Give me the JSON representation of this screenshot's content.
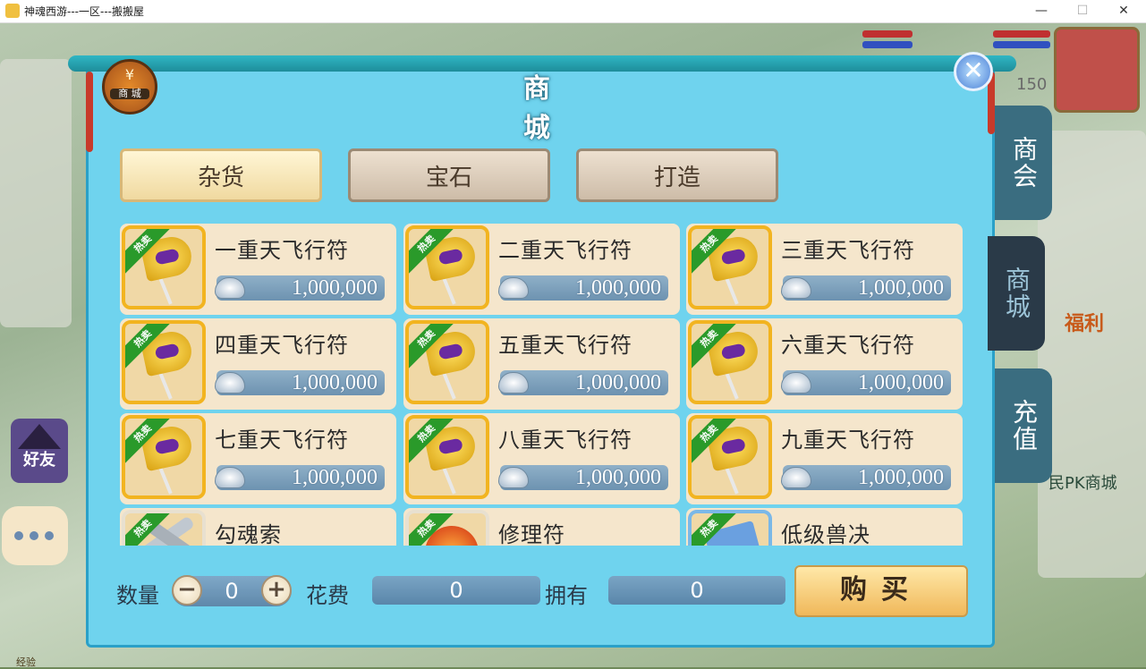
{
  "window": {
    "title": "神魂西游---一区---搬搬屋",
    "minimize": "—",
    "maximize": "☐",
    "close": "✕"
  },
  "background": {
    "level": "150",
    "welfare": "福利",
    "pk_shop": "民PK商城",
    "friend": "好友",
    "exp": "经验"
  },
  "shop": {
    "title": "商 城",
    "badge_symbol": "¥",
    "badge_label": "商 城",
    "close_symbol": "✕",
    "side_tabs": [
      {
        "label": "商会",
        "active": false
      },
      {
        "label": "商城",
        "active": true
      },
      {
        "label": "充值",
        "active": false
      }
    ],
    "category_tabs": [
      {
        "label": "杂货",
        "active": true
      },
      {
        "label": "宝石",
        "active": false
      },
      {
        "label": "打造",
        "active": false
      }
    ],
    "hot_tag": "热卖",
    "items": [
      {
        "name": "一重天飞行符",
        "price": "1,000,000",
        "icon": "flag-icon"
      },
      {
        "name": "二重天飞行符",
        "price": "1,000,000",
        "icon": "flag-icon"
      },
      {
        "name": "三重天飞行符",
        "price": "1,000,000",
        "icon": "flag-icon"
      },
      {
        "name": "四重天飞行符",
        "price": "1,000,000",
        "icon": "flag-icon"
      },
      {
        "name": "五重天飞行符",
        "price": "1,000,000",
        "icon": "flag-icon"
      },
      {
        "name": "六重天飞行符",
        "price": "1,000,000",
        "icon": "flag-icon"
      },
      {
        "name": "七重天飞行符",
        "price": "1,000,000",
        "icon": "flag-icon"
      },
      {
        "name": "八重天飞行符",
        "price": "1,000,000",
        "icon": "flag-icon"
      },
      {
        "name": "九重天飞行符",
        "price": "1,000,000",
        "icon": "flag-icon"
      },
      {
        "name": "勾魂索",
        "price": "",
        "icon": "hook-rope-icon"
      },
      {
        "name": "修理符",
        "price": "",
        "icon": "repair-orb-icon"
      },
      {
        "name": "低级兽决",
        "price": "",
        "icon": "skill-book-icon"
      }
    ],
    "quantity_label": "数量",
    "quantity_value": "0",
    "minus": "−",
    "plus": "+",
    "cost_label": "花费",
    "cost_value": "0",
    "owned_label": "拥有",
    "owned_value": "0",
    "buy_label": "购买"
  }
}
